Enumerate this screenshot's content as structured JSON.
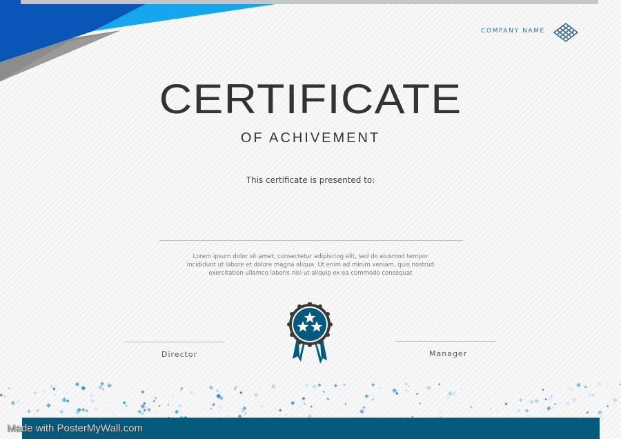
{
  "header": {
    "company_name": "COMPANY NAME"
  },
  "certificate": {
    "title": "CERTIFICATE",
    "subtitle": "OF ACHIVEMENT",
    "presented_to": "This certificate is presented to:",
    "body_text": "Lorem ipsum dolor sit amet, consectetur adipiscing elit, sed do eiusmod tempor incididunt ut labore et dolore magna aliqua. Ut enim ad minim veniam, quis nostrud exercitation ullamco laboris nisi ut aliquip ex ea commodo consequat"
  },
  "signatures": {
    "left_label": "Director",
    "right_label": "Manager"
  },
  "icons": {
    "company_logo": "lattice-knot-icon",
    "badge": "award-rosette-three-stars-icon"
  },
  "colors": {
    "accent_teal": "#045a7c",
    "corner_blue_dark": "#0a4fa8",
    "corner_blue_light": "#16a6ee",
    "corner_gray": "#8c8c8c",
    "title_text": "#333333",
    "background": "#f3f3f4"
  },
  "watermark": "Made with PosterMyWall.com"
}
